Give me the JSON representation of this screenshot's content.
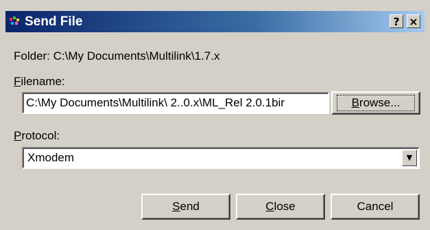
{
  "window": {
    "title": "Send File",
    "help_glyph": "?",
    "close_glyph": "×"
  },
  "folder": {
    "label": "Folder:",
    "path": "C:\\My Documents\\Multilink\\1.7.x"
  },
  "filename": {
    "label_mnemonic": "F",
    "label_rest": "ilename:",
    "value": "C:\\My Documents\\Multilink\\ 2..0.x\\ML_Rel 2.0.1bir"
  },
  "browse": {
    "mnemonic": "B",
    "rest": "rowse..."
  },
  "protocol": {
    "label_mnemonic": "P",
    "label_rest": "rotocol:",
    "selected": "Xmodem",
    "arrow_glyph": "▼"
  },
  "buttons": {
    "send_mnemonic": "S",
    "send_rest": "end",
    "close_mnemonic": "C",
    "close_rest": "lose",
    "cancel": "Cancel"
  }
}
